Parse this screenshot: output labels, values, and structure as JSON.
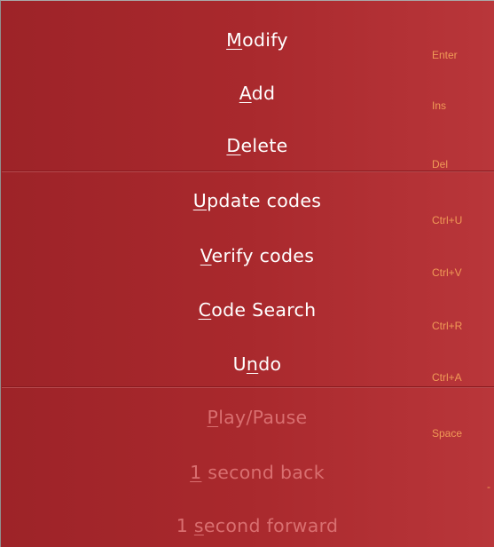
{
  "menu": {
    "items": [
      {
        "pre": "",
        "key": "M",
        "post": "odify",
        "shortcut": "Enter",
        "enabled": true
      },
      {
        "pre": "",
        "key": "A",
        "post": "dd",
        "shortcut": "Ins",
        "enabled": true
      },
      {
        "pre": "",
        "key": "D",
        "post": "elete",
        "shortcut": "Del",
        "enabled": true
      },
      {
        "pre": "",
        "key": "U",
        "post": "pdate codes",
        "shortcut": "Ctrl+U",
        "enabled": true
      },
      {
        "pre": "",
        "key": "V",
        "post": "erify codes",
        "shortcut": "Ctrl+V",
        "enabled": true
      },
      {
        "pre": "",
        "key": "C",
        "post": "ode Search",
        "shortcut": "Ctrl+R",
        "enabled": true
      },
      {
        "pre": "U",
        "key": "n",
        "post": "do",
        "shortcut": "Ctrl+A",
        "enabled": true
      },
      {
        "pre": "",
        "key": "P",
        "post": "lay/Pause",
        "shortcut": "Space",
        "enabled": false
      },
      {
        "pre": "",
        "key": "1",
        "post": " second back",
        "shortcut": "-",
        "enabled": false
      },
      {
        "pre": "1 ",
        "key": "s",
        "post": "econd forward",
        "shortcut": "",
        "enabled": false
      }
    ]
  },
  "colors": {
    "background": "#a9292d",
    "text": "#ffffff",
    "text_disabled": "#d96f70",
    "shortcut": "#f09a57"
  }
}
